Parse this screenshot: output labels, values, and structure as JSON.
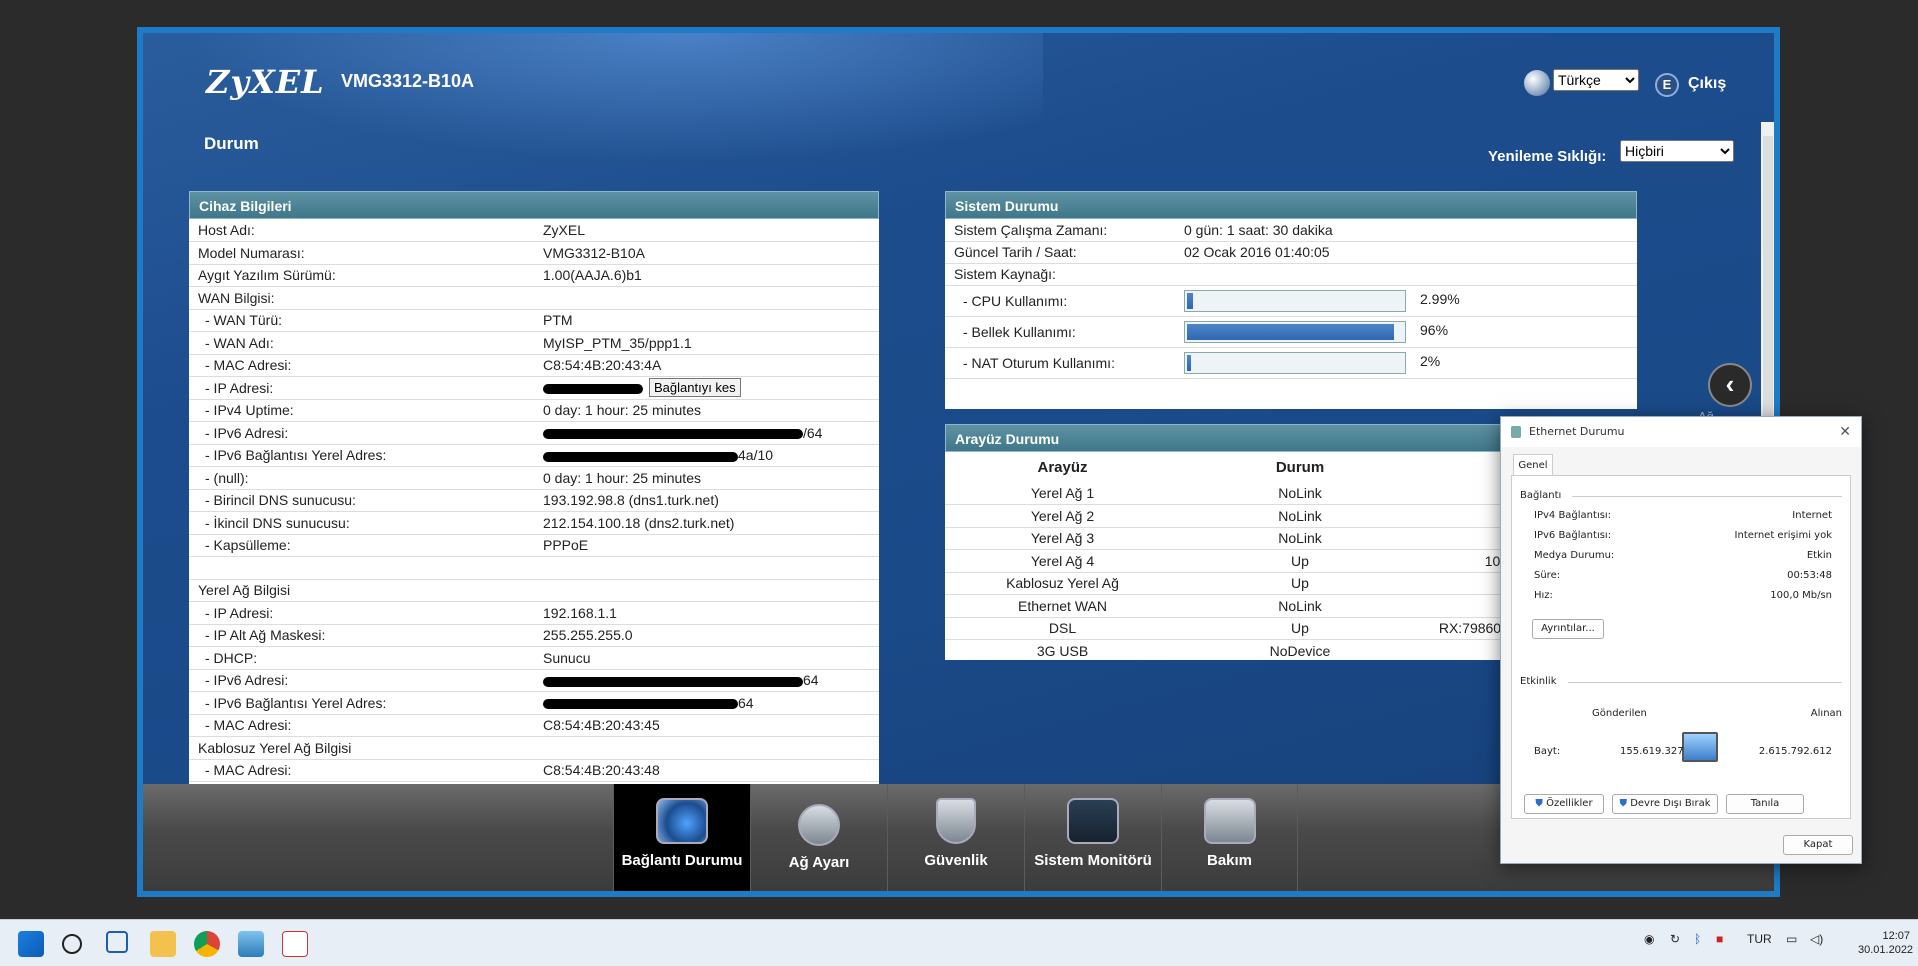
{
  "header": {
    "logo": "ZyXEL",
    "model": "VMG3312-B10A",
    "page_title": "Durum",
    "language": "Türkçe",
    "logout": "Çıkış",
    "refresh_label": "Yenileme Sıklığı:",
    "refresh_value": "Hiçbiri",
    "back_label": "Ağ"
  },
  "device": {
    "title": "Cihaz Bilgileri",
    "rows": [
      {
        "k": "Host Adı:",
        "v": "ZyXEL"
      },
      {
        "k": "Model Numarası:",
        "v": "VMG3312-B10A"
      },
      {
        "k": "Aygıt Yazılım Sürümü:",
        "v": "1.00(AAJA.6)b1"
      },
      {
        "k": "WAN Bilgisi:",
        "v": ""
      },
      {
        "k": "- WAN Türü:",
        "v": "PTM"
      },
      {
        "k": "- WAN Adı:",
        "v": "MyISP_PTM_35/ppp1.1"
      },
      {
        "k": "- MAC Adresi:",
        "v": "C8:54:4B:20:43:4A"
      },
      {
        "k": "- IP Adresi:",
        "v": ""
      },
      {
        "k": "- IPv4 Uptime:",
        "v": "0 day: 1 hour: 25 minutes"
      },
      {
        "k": "- IPv6 Adresi:",
        "v": "/64"
      },
      {
        "k": "- IPv6 Bağlantısı Yerel Adres:",
        "v": "4a/10"
      },
      {
        "k": "- (null):",
        "v": "0 day: 1 hour: 25 minutes"
      },
      {
        "k": "- Birincil DNS sunucusu:",
        "v": "193.192.98.8 (dns1.turk.net)"
      },
      {
        "k": "- İkincil DNS sunucusu:",
        "v": "212.154.100.18 (dns2.turk.net)"
      },
      {
        "k": "- Kapsülleme:",
        "v": "PPPoE"
      },
      {
        "k": "",
        "v": ""
      },
      {
        "k": "Yerel Ağ Bilgisi",
        "v": ""
      },
      {
        "k": "- IP Adresi:",
        "v": "192.168.1.1"
      },
      {
        "k": "- IP Alt Ağ Maskesi:",
        "v": "255.255.255.0"
      },
      {
        "k": "- DHCP:",
        "v": "Sunucu"
      },
      {
        "k": "- IPv6 Adresi:",
        "v": "64"
      },
      {
        "k": "- IPv6 Bağlantısı Yerel Adres:",
        "v": "64"
      },
      {
        "k": "- MAC Adresi:",
        "v": "C8:54:4B:20:43:45"
      },
      {
        "k": "Kablosuz Yerel Ağ Bilgisi",
        "v": ""
      },
      {
        "k": "- MAC Adresi:",
        "v": "C8:54:4B:20:43:48"
      }
    ],
    "disconnect_button": "Bağlantıyı kes"
  },
  "system": {
    "title": "Sistem Durumu",
    "uptime_label": "Sistem Çalışma Zamanı:",
    "uptime": "0 gün: 1 saat: 30 dakika",
    "datetime_label": "Güncel Tarih / Saat:",
    "datetime": "02 Ocak 2016 01:40:05",
    "resource_label": "Sistem Kaynağı:",
    "cpu_label": "- CPU Kullanımı:",
    "cpu": "2.99%",
    "cpu_fraction": 0.03,
    "mem_label": "- Bellek Kullanımı:",
    "mem": "96%",
    "mem_fraction": 0.96,
    "nat_label": "- NAT Oturum Kullanımı:",
    "nat": "2%",
    "nat_fraction": 0.02
  },
  "iface": {
    "title": "Arayüz Durumu",
    "col_iface": "Arayüz",
    "col_status": "Durum",
    "rows": [
      {
        "name": "Yerel Ağ 1",
        "status": "NoLink",
        "extra": ""
      },
      {
        "name": "Yerel Ağ 2",
        "status": "NoLink",
        "extra": ""
      },
      {
        "name": "Yerel Ağ 3",
        "status": "NoLink",
        "extra": ""
      },
      {
        "name": "Yerel Ağ 4",
        "status": "Up",
        "extra": "10("
      },
      {
        "name": "Kablosuz Yerel Ağ",
        "status": "Up",
        "extra": ""
      },
      {
        "name": "Ethernet WAN",
        "status": "NoLink",
        "extra": ""
      },
      {
        "name": "DSL",
        "status": "Up",
        "extra": "RX:79860/"
      },
      {
        "name": "3G USB",
        "status": "NoDevice",
        "extra": ""
      }
    ]
  },
  "nav": {
    "items": [
      "Bağlantı Durumu",
      "Ağ Ayarı",
      "Güvenlik",
      "Sistem Monitörü",
      "Bakım"
    ]
  },
  "dialog": {
    "title": "Ethernet Durumu",
    "tab": "Genel",
    "conn_group": "Bağlantı",
    "ipv4_label": "IPv4 Bağlantısı:",
    "ipv4": "Internet",
    "ipv6_label": "IPv6 Bağlantısı:",
    "ipv6": "Internet erişimi yok",
    "media_label": "Medya Durumu:",
    "media": "Etkin",
    "duration_label": "Süre:",
    "duration": "00:53:48",
    "speed_label": "Hız:",
    "speed": "100,0 Mb/sn",
    "details_button": "Ayrıntılar...",
    "activity_group": "Etkinlik",
    "sent_label": "Gönderilen",
    "recv_label": "Alınan",
    "bytes_label": "Bayt:",
    "sent": "155.619.327",
    "recv": "2.615.792.612",
    "props_button": "Özellikler",
    "disable_button": "Devre Dışı Bırak",
    "diagnose_button": "Tanıla",
    "close_button": "Kapat"
  },
  "taskbar": {
    "lang": "TUR",
    "time": "12:07",
    "date": "30.01.2022"
  }
}
